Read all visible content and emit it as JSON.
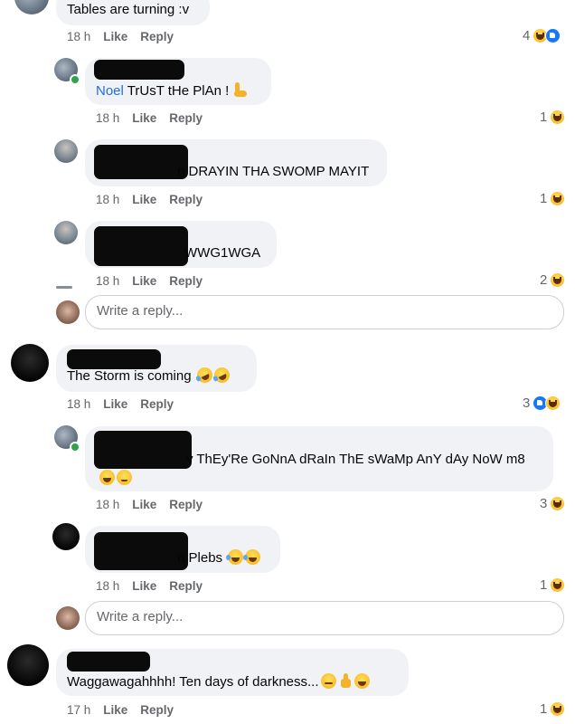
{
  "comments": [
    {
      "text": "Tables are turning :v",
      "time": "18 h",
      "like": "Like",
      "reply": "Reply",
      "reactions": "4"
    },
    {
      "mention": "Noel",
      "text": " TrUsT tHe PlAn !",
      "time": "18 h",
      "like": "Like",
      "reply": "Reply",
      "reactions": "1"
    },
    {
      "text": "n DRAYIN THA SWOMP MAYIT",
      "time": "18 h",
      "like": "Like",
      "reply": "Reply",
      "reactions": "1"
    },
    {
      "text": "WWG1WGA",
      "time": "18 h",
      "like": "Like",
      "reply": "Reply",
      "reactions": "2"
    },
    {
      "text": "The Storm is coming",
      "time": "18 h",
      "like": "Like",
      "reply": "Reply",
      "reactions": "3"
    },
    {
      "text": "y ThEy'Re GoNnA dRaIn ThE sWaMp AnY dAy NoW m8",
      "time": "18 h",
      "like": "Like",
      "reply": "Reply",
      "reactions": "3"
    },
    {
      "text": "n Plebs",
      "time": "18 h",
      "like": "Like",
      "reply": "Reply",
      "reactions": "1"
    },
    {
      "text": "Waggawagahhhh! Ten days of darkness...",
      "time": "17 h",
      "like": "Like",
      "reply": "Reply",
      "reactions": "1"
    }
  ],
  "reply_placeholder": "Write a reply...",
  "colors": {
    "accent": "#216fdb",
    "bubble": "#f0f2f5",
    "meta": "#65676b"
  }
}
